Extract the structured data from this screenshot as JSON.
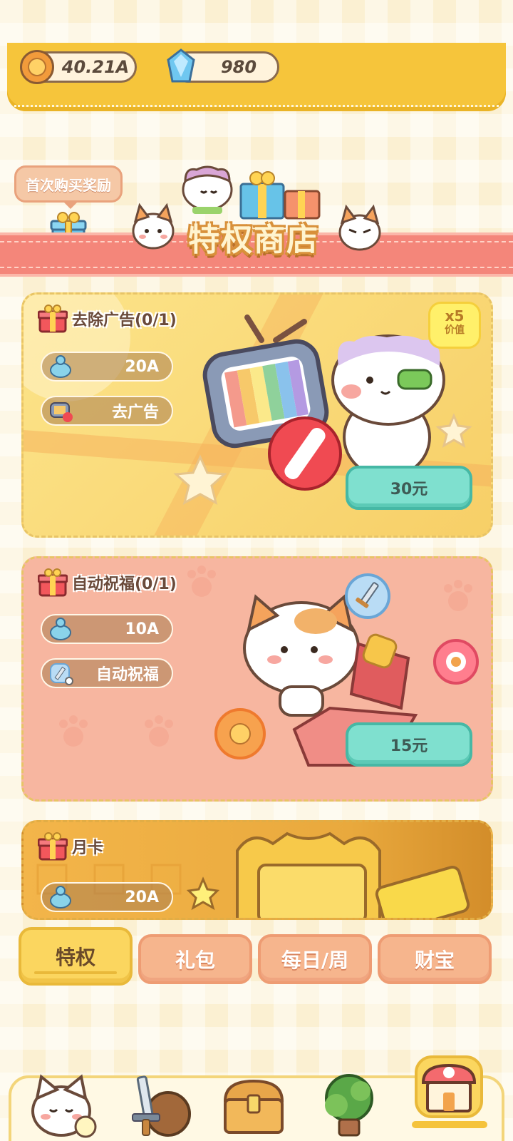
{
  "currency": {
    "coins": "40.21A",
    "gems": "980"
  },
  "first_purchase_label": "首次购买奖励",
  "shop_title": "特权商店",
  "cards": [
    {
      "title": "去除广告(0/1)",
      "reward_amount": "20A",
      "perk_label": "去广告",
      "price": "30元",
      "value_badge_multiplier": "x5",
      "value_badge_label": "价值"
    },
    {
      "title": "自动祝福(0/1)",
      "reward_amount": "10A",
      "perk_label": "自动祝福",
      "price": "15元"
    },
    {
      "title": "月卡",
      "reward_amount": "20A"
    }
  ],
  "tabs": [
    {
      "label": "特权",
      "active": true
    },
    {
      "label": "礼包",
      "active": false
    },
    {
      "label": "每日/周",
      "active": false
    },
    {
      "label": "财宝",
      "active": false
    }
  ],
  "bottom_nav": [
    {
      "icon": "cat-home-icon",
      "selected": false
    },
    {
      "icon": "sword-shield-icon",
      "selected": false
    },
    {
      "icon": "treasure-chest-icon",
      "selected": false
    },
    {
      "icon": "tree-icon",
      "selected": false
    },
    {
      "icon": "shop-icon",
      "selected": true
    }
  ],
  "colors": {
    "top_bar": "#f6c53b",
    "ribbon": "#f4867a",
    "price_button": "#7fe0cf",
    "tab_active": "#fbd65f",
    "tab_inactive": "#f6b58d"
  }
}
